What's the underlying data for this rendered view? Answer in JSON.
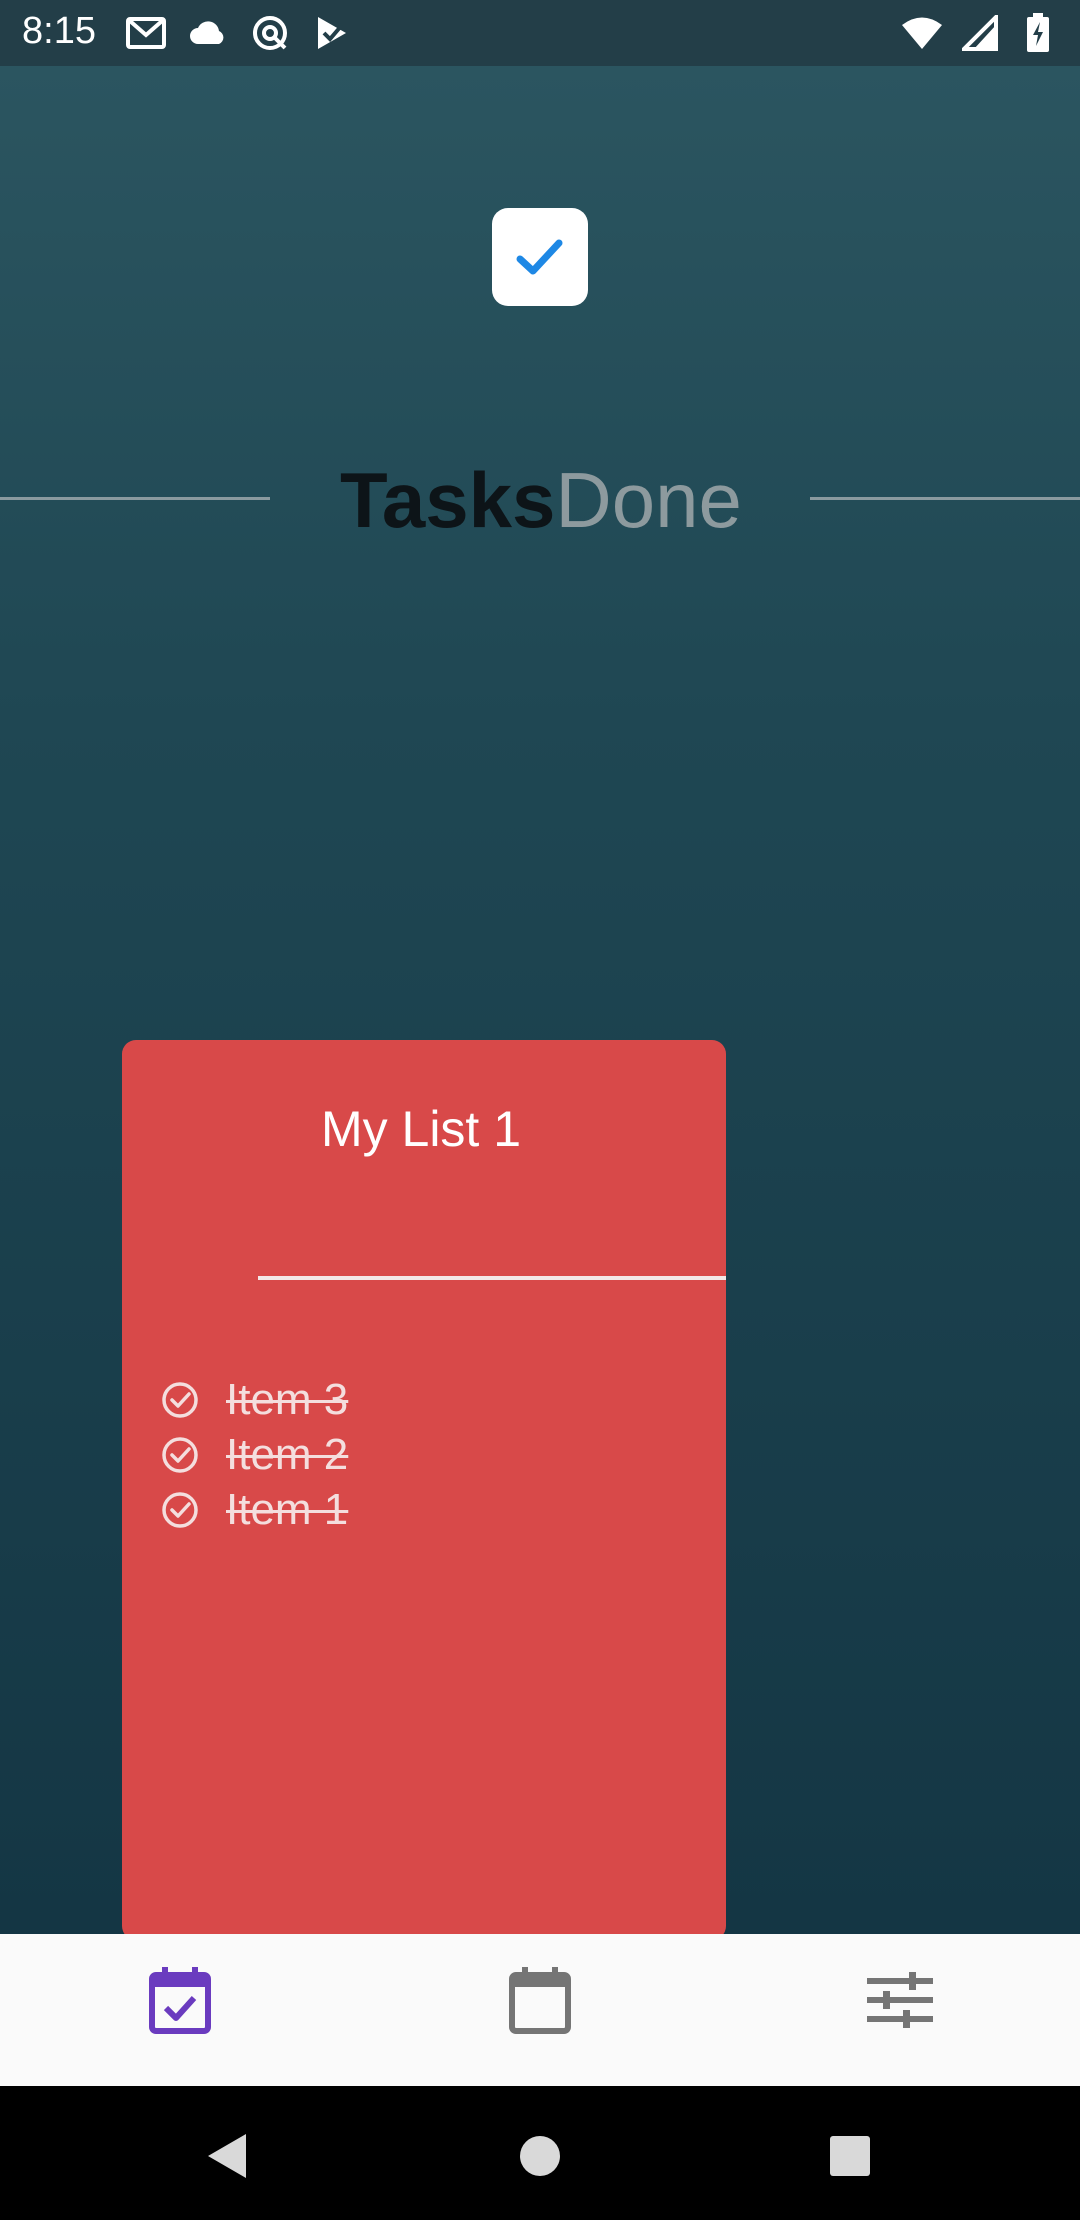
{
  "status_bar": {
    "time": "8:15",
    "left_icons": [
      "gmail-icon",
      "cloud-icon",
      "sync-icon",
      "play-store-icon"
    ],
    "right_icons": [
      "wifi-icon",
      "signal-icon",
      "battery-charging-icon"
    ]
  },
  "app": {
    "logo_icon": "check-icon",
    "title_bold": "Tasks",
    "title_light": "Done"
  },
  "card": {
    "title": "My List 1",
    "color": "#d84949",
    "items": [
      {
        "label": "Item 3",
        "done": true
      },
      {
        "label": "Item 2",
        "done": true
      },
      {
        "label": "Item 1",
        "done": true
      }
    ]
  },
  "bottom_nav": {
    "items": [
      {
        "name": "tasks",
        "icon": "calendar-check-icon",
        "active": true
      },
      {
        "name": "calendar",
        "icon": "calendar-icon",
        "active": false
      },
      {
        "name": "settings",
        "icon": "sliders-icon",
        "active": false
      }
    ],
    "active_color": "#6a3bbf",
    "inactive_color": "#757575"
  },
  "system_nav": {
    "buttons": [
      "back-icon",
      "home-icon",
      "recents-icon"
    ]
  }
}
